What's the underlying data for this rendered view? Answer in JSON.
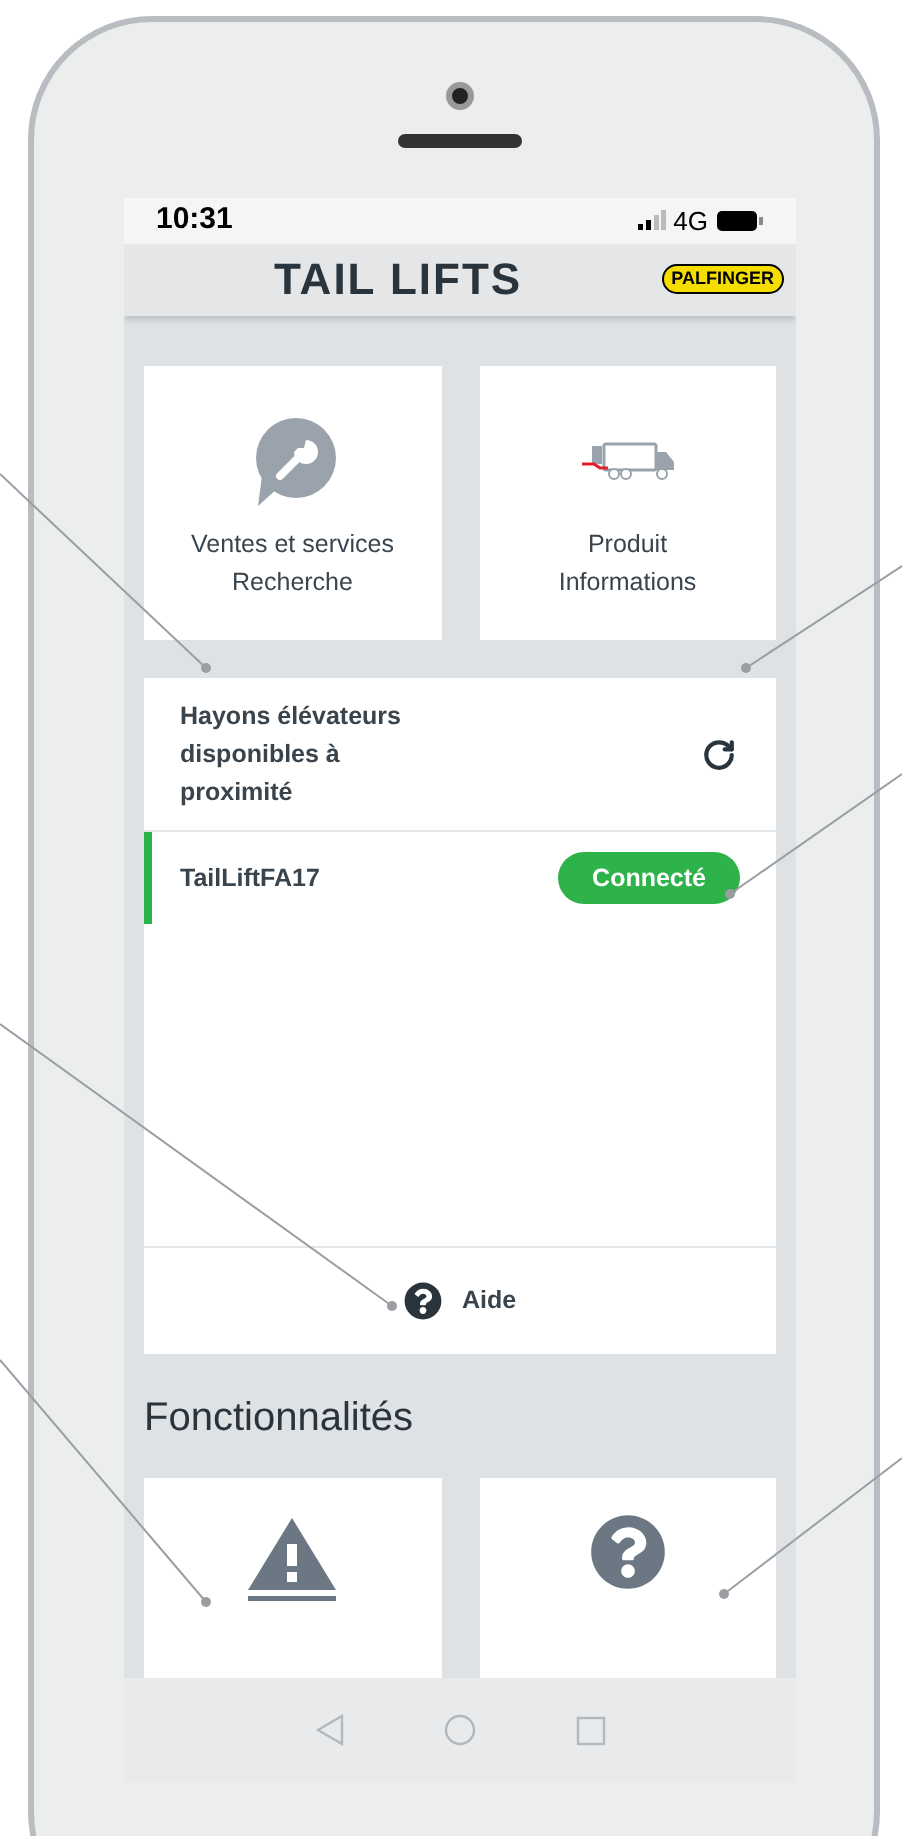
{
  "status_bar": {
    "time": "10:31",
    "network": "4G"
  },
  "header": {
    "title": "TAIL LIFTS",
    "brand": "PALFINGER"
  },
  "tiles": [
    {
      "kind": "service",
      "label": "Ventes et services\nRecherche"
    },
    {
      "kind": "truck",
      "label": "Produit\nInformations"
    }
  ],
  "devices": {
    "title": "Hayons élévateurs\ndisponibles à\nproximité",
    "items": [
      {
        "name": "TailLiftFA17",
        "status": "Connecté",
        "selected": true
      }
    ],
    "help": "Aide"
  },
  "section_title": "Fonctionnalités",
  "feature_tiles": [
    {
      "kind": "warning"
    },
    {
      "kind": "help"
    }
  ]
}
